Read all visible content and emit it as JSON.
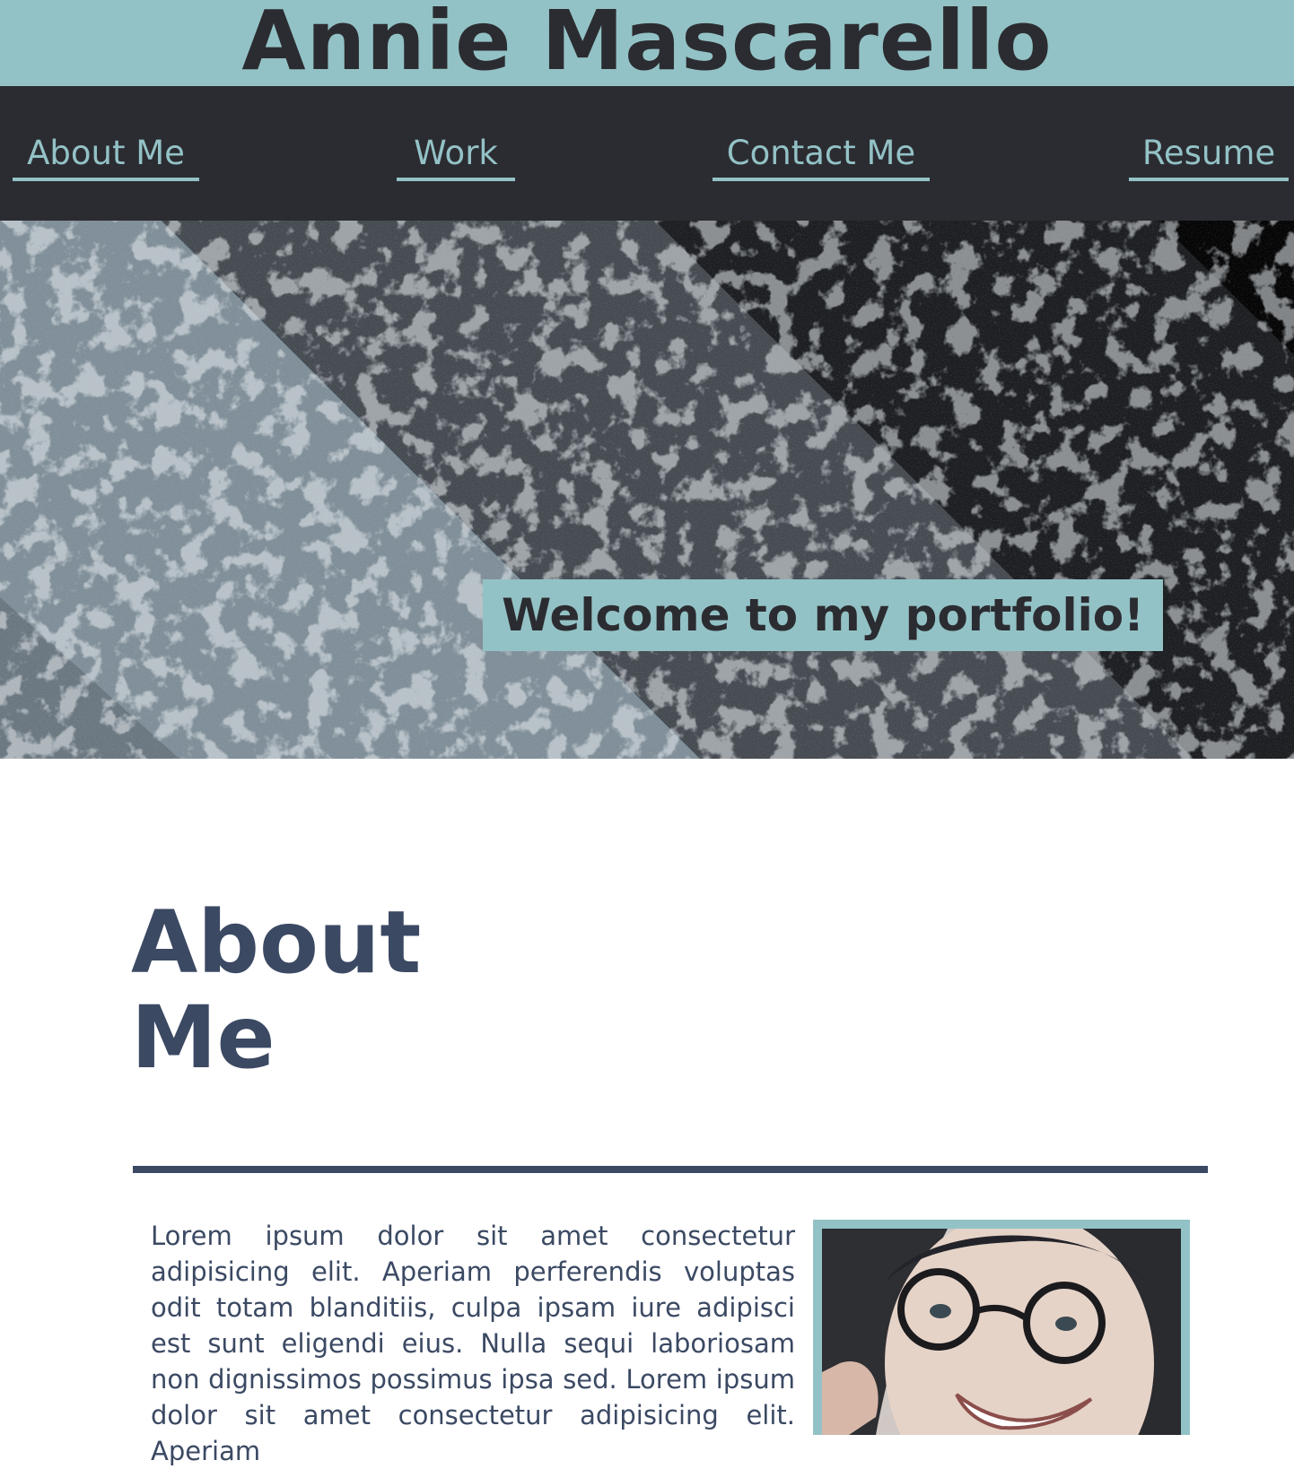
{
  "header": {
    "title": "Annie Mascarello"
  },
  "nav": {
    "items": [
      {
        "label": "About Me"
      },
      {
        "label": "Work"
      },
      {
        "label": "Contact Me"
      },
      {
        "label": "Resume"
      }
    ]
  },
  "hero": {
    "banner_text": "Welcome to my portfolio!"
  },
  "about": {
    "heading": "About Me",
    "body": "Lorem ipsum dolor sit amet consectetur adipisicing elit. Aperiam perferendis voluptas odit totam blanditiis, culpa ipsam iure adipisci est sunt eligendi eius. Nulla sequi laboriosam non dignissimos possimus ipsa sed. Lorem ipsum dolor sit amet consectetur adipisicing elit. Aperiam",
    "photo_icon": "portrait-photo"
  },
  "colors": {
    "accent": "#93c2c6",
    "dark": "#2b2c31",
    "heading": "#3b4963"
  }
}
